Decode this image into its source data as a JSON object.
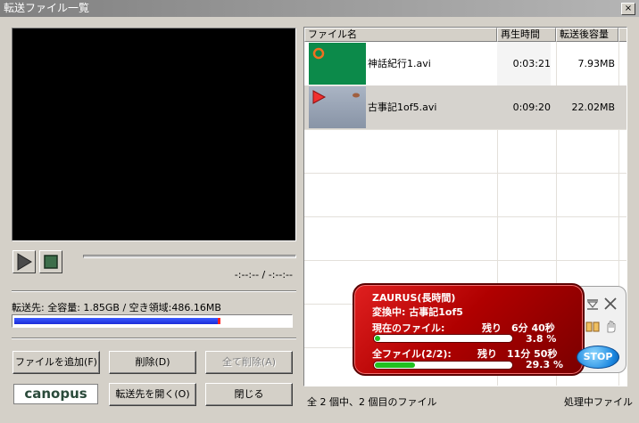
{
  "window": {
    "title": "転送ファイル一覧",
    "close_glyph": "×"
  },
  "player": {
    "time": "-:--:-- / -:--:--"
  },
  "capacity": {
    "text": "転送先: 全容量: 1.85GB / 空き領域:486.16MB",
    "used_fraction": 0.737
  },
  "buttons": {
    "add_file": "ファイルを追加(F)",
    "delete": "削除(D)",
    "delete_all": "全て削除(A)",
    "open_dest": "転送先を開く(O)",
    "close": "閉じる",
    "logo": "canopus"
  },
  "file_list": {
    "columns": [
      "ファイル名",
      "再生時間",
      "転送後容量"
    ],
    "rows": [
      {
        "name": "神話紀行1.avi",
        "duration": "0:03:21",
        "size": "7.93MB"
      },
      {
        "name": "古事記1of5.avi",
        "duration": "0:09:20",
        "size": "22.02MB"
      }
    ]
  },
  "status": {
    "left": "全 2 個中、2 個目のファイル",
    "right": "処理中ファイル"
  },
  "widget": {
    "device": "ZAURUS(長時間)",
    "converting": "変換中: 古事記1of5",
    "current_label": "現在のファイル:",
    "current_remaining": "残り　6分 40秒",
    "current_percent": "3.8 %",
    "current_fraction": 0.038,
    "all_label": "全ファイル(2/2):",
    "all_remaining": "残り　11分 50秒",
    "all_percent": "29.3 %",
    "all_fraction": 0.293,
    "stop_label": "STOP"
  },
  "colors": {
    "capacity_fill": "#2a3ef0",
    "widget_red": "#c00000",
    "progress_green": "#20c020"
  }
}
